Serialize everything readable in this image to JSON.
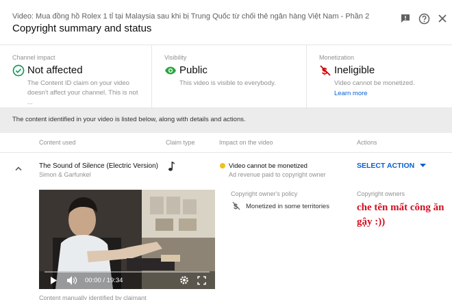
{
  "header": {
    "subtitle": "Video: Mua đồng hồ Rolex 1 tỉ tại Malaysia sau khi bị Trung Quốc từ chối thẻ ngân hàng Việt Nam - Phần 2",
    "title": "Copyright summary and status",
    "icons": [
      "feedback-icon",
      "help-icon",
      "close-icon"
    ]
  },
  "summary": {
    "channel": {
      "label": "Channel impact",
      "status": "Not affected",
      "description": "The Content ID claim on your video doesn't affect your channel. This is not ...",
      "icon": "check-circle-icon",
      "color": "#0f9d58"
    },
    "visibility": {
      "label": "Visibility",
      "status": "Public",
      "description": "This video is visible to everybody.",
      "icon": "eye-icon",
      "color": "#2ba640"
    },
    "monetization": {
      "label": "Monetization",
      "status": "Ineligible",
      "description": "Video cannot be monetized.",
      "link": "Learn more",
      "icon": "no-money-icon",
      "color": "#cc0000"
    }
  },
  "info_bar": "The content identified in your video is listed below, along with details and actions.",
  "table": {
    "headers": {
      "content": "Content used",
      "claim_type": "Claim type",
      "impact": "Impact on the video",
      "actions": "Actions"
    },
    "row": {
      "song": "The Sound of Silence (Electric Version)",
      "artist": "Simon & Garfunkel",
      "claim_icon": "music-note-icon",
      "impact": "Video cannot be monetized",
      "impact_sub": "Ad revenue paid to copyright owner",
      "impact_color": "#f2c01c",
      "action": "SELECT ACTION",
      "policy_label": "Copyright owner's policy",
      "policy_value": "Monetized in some territories",
      "owners_label": "Copyright owners",
      "owners_overlay": "che tên mất công ăn gậy :))",
      "video_time": "00:00 / 19:34",
      "identified": "Content manually identified by claimant"
    }
  },
  "colors": {
    "link": "#065fd4",
    "overlay_text": "#d01020"
  }
}
